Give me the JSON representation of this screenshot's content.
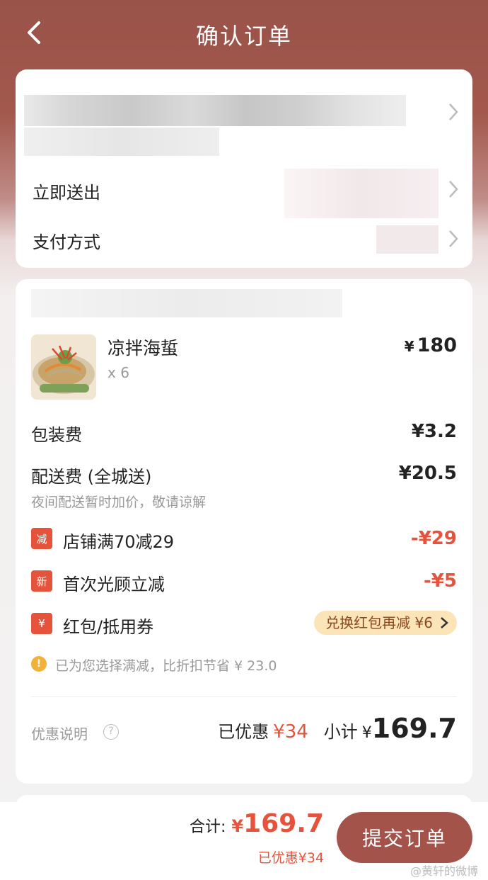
{
  "header": {
    "title": "确认订单"
  },
  "address_card": {
    "delivery_time": "立即送出",
    "payment_method": "支付方式"
  },
  "order": {
    "items": [
      {
        "name": "凉拌海蜇",
        "qty": "x 6",
        "price": "180",
        "currency": "¥"
      }
    ],
    "packaging_fee": {
      "label": "包装费",
      "amount": "¥3.2"
    },
    "delivery_fee": {
      "label": "配送费 (全城送)",
      "amount": "¥20.5",
      "note": "夜间配送暂时加价，敬请谅解"
    },
    "discounts": [
      {
        "icon": "减",
        "label": "店铺满70减29",
        "amount": "-¥29"
      },
      {
        "icon": "新",
        "label": "首次光顾立减",
        "amount": "-¥5"
      }
    ],
    "coupon": {
      "icon": "¥",
      "label": "红包/抵用券",
      "action": "兑换红包再减 ¥6"
    },
    "hint": "已为您选择满减，比折扣节省 ¥ 23.0",
    "discount_info_label": "优惠说明",
    "saved_label": "已优惠",
    "saved_amount": "¥34",
    "subtotal_label": "小计",
    "subtotal_currency": "¥",
    "subtotal_amount": "169.7"
  },
  "footer": {
    "total_label": "合计:",
    "total_currency": "¥",
    "total_amount": "169.7",
    "saved_text": "已优惠¥34",
    "submit_label": "提交订单",
    "watermark": "@黄轩的微博"
  },
  "colors": {
    "brand": "#a4534a",
    "accent": "#e5533c"
  }
}
